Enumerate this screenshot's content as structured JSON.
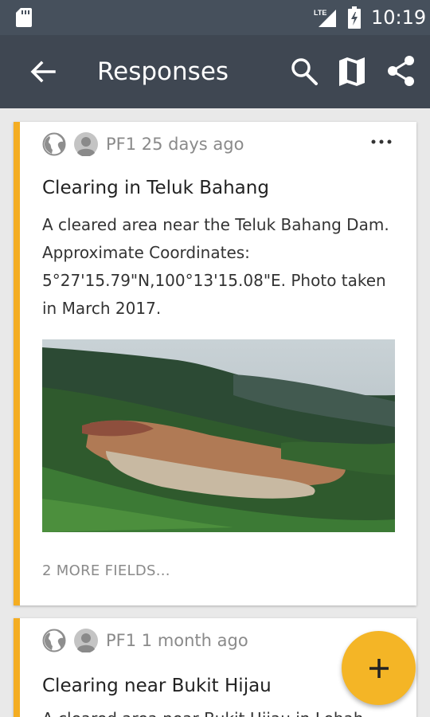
{
  "status_bar": {
    "time": "10:19",
    "network": "LTE",
    "icons": [
      "sd-card-icon",
      "signal-icon",
      "battery-icon"
    ]
  },
  "app_bar": {
    "title": "Responses",
    "icons": [
      "back-arrow-icon",
      "search-icon",
      "map-icon",
      "share-icon"
    ]
  },
  "responses": [
    {
      "author": "PF1",
      "age": "25 days ago",
      "meta": "PF1 25 days ago",
      "title": "Clearing in Teluk Bahang",
      "description": "A cleared area near the Teluk Bahang Dam. Approximate Coordinates: 5°27'15.79\"N,100°13'15.08\"E. Photo taken in March 2017.",
      "more_fields": "2 MORE FIELDS..."
    },
    {
      "author": "PF1",
      "age": "1 month ago",
      "meta": "PF1 1 month ago",
      "title": "Clearing near Bukit Hijau",
      "description_partial": "A cleared area near Bukit Hijau in Lebah"
    }
  ],
  "fab": {
    "label": "+",
    "icon": "add-icon"
  },
  "colors": {
    "status_bar": "#46505c",
    "app_bar": "#3f4752",
    "accent": "#f4ad22",
    "fab": "#f4b526",
    "background": "#e9e9e9"
  }
}
